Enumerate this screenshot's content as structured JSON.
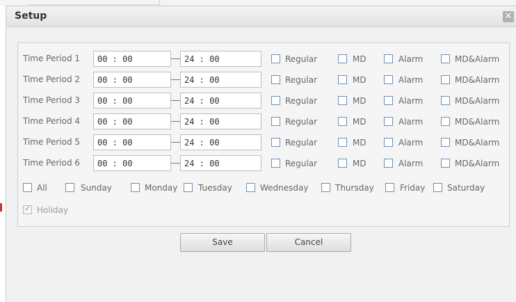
{
  "dialog": {
    "title": "Setup",
    "close_glyph": "✕"
  },
  "period_prefix": "Time Period",
  "periods": [
    {
      "label": "Time Period 1",
      "start": "00 : 00",
      "end": "24 : 00"
    },
    {
      "label": "Time Period 2",
      "start": "00 : 00",
      "end": "24 : 00"
    },
    {
      "label": "Time Period 3",
      "start": "00 : 00",
      "end": "24 : 00"
    },
    {
      "label": "Time Period 4",
      "start": "00 : 00",
      "end": "24 : 00"
    },
    {
      "label": "Time Period 5",
      "start": "00 : 00",
      "end": "24 : 00"
    },
    {
      "label": "Time Period 6",
      "start": "00 : 00",
      "end": "24 : 00"
    }
  ],
  "record_types": [
    "Regular",
    "MD",
    "Alarm",
    "MD&Alarm"
  ],
  "days": [
    "All",
    "Sunday",
    "Monday",
    "Tuesday",
    "Wednesday",
    "Thursday",
    "Friday",
    "Saturday"
  ],
  "holiday": {
    "label": "Holiday",
    "checked": true
  },
  "buttons": {
    "save": "Save",
    "cancel": "Cancel"
  }
}
